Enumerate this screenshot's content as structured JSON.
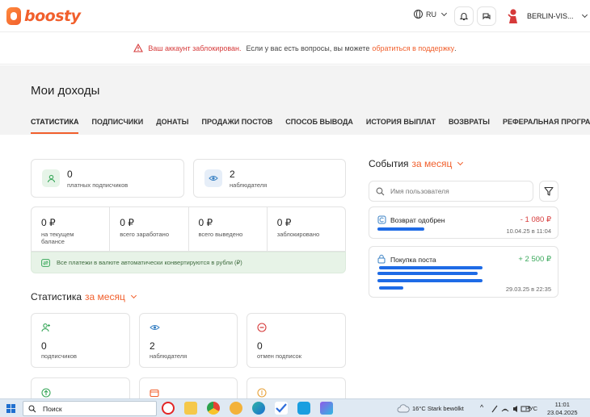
{
  "header": {
    "logo_text": "boosty",
    "language": "RU",
    "user_name": "BERLIN-VIS..."
  },
  "banner": {
    "strong": "Ваш аккаунт заблокирован.",
    "text": "Если у вас есть вопросы, вы можете",
    "link": "обратиться в поддержку",
    "end": "."
  },
  "page": {
    "title": "Мои доходы",
    "tabs": [
      {
        "label": "СТАТИСТИКА",
        "active": true
      },
      {
        "label": "ПОДПИСЧИКИ",
        "active": false
      },
      {
        "label": "ДОНАТЫ",
        "active": false
      },
      {
        "label": "ПРОДАЖИ ПОСТОВ",
        "active": false
      },
      {
        "label": "СПОСОБ ВЫВОДА",
        "active": false
      },
      {
        "label": "ИСТОРИЯ ВЫПЛАТ",
        "active": false
      },
      {
        "label": "ВОЗВРАТЫ",
        "active": false
      },
      {
        "label": "РЕФЕРАЛЬНАЯ ПРОГРАММА",
        "active": false
      }
    ]
  },
  "summary": {
    "paid_subscribers": {
      "value": "0",
      "label": "платных подписчиков"
    },
    "followers": {
      "value": "2",
      "label": "наблюдателя"
    }
  },
  "balance": [
    {
      "value": "0 ₽",
      "label": "на текущем балансе"
    },
    {
      "value": "0 ₽",
      "label": "всего заработано"
    },
    {
      "value": "0 ₽",
      "label": "всего выведено"
    },
    {
      "value": "0 ₽",
      "label": "заблокировано"
    }
  ],
  "currency_note": "Все платежи в валюте автоматически конвертируются в рубли (₽)",
  "statistics": {
    "title": "Статистика",
    "period": "за месяц",
    "cards": [
      {
        "value": "0",
        "label": "подписчиков",
        "icon": "user-plus-icon",
        "color": "#3aa85b"
      },
      {
        "value": "2",
        "label": "наблюдателя",
        "icon": "eye-icon",
        "color": "#3b82c4"
      },
      {
        "value": "0",
        "label": "отмен подписок",
        "icon": "minus-circle-icon",
        "color": "#d63a3a"
      }
    ],
    "cards_row2_icons": [
      {
        "icon": "arrow-up-circle-icon",
        "color": "#3aa85b"
      },
      {
        "icon": "wallet-icon",
        "color": "#f15f2c"
      },
      {
        "icon": "coin-icon",
        "color": "#e8a23a"
      }
    ]
  },
  "events": {
    "title": "События",
    "period": "за месяц",
    "search_placeholder": "Имя пользователя",
    "items": [
      {
        "title": "Возврат одобрен",
        "amount": "- 1 080 ₽",
        "date": "10.04.25 в 11:04",
        "amount_color": "#d63a3a",
        "icon": "refund-icon"
      },
      {
        "title": "Покупка поста",
        "amount": "+ 2 500 ₽",
        "date": "29.03.25 в 22:35",
        "amount_color": "#3aa85b",
        "icon": "lock-icon"
      }
    ]
  },
  "taskbar": {
    "search_label": "Поиск",
    "weather": "16°C  Stark bewölkt",
    "lang": "РУС",
    "time": "11:01",
    "date": "23.04.2025"
  }
}
